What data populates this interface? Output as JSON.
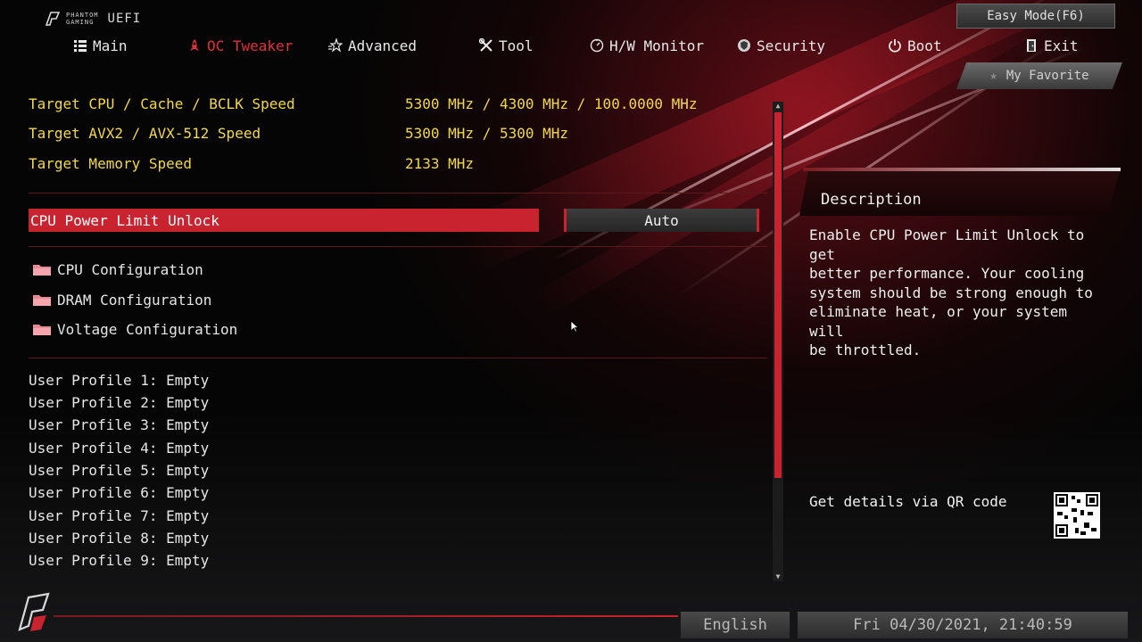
{
  "header": {
    "brand_top": "PHANTOM",
    "brand_bottom": "GAMING",
    "brand_suffix": "UEFI",
    "easy_mode_label": "Easy Mode(F6)",
    "favorite_label": "My Favorite"
  },
  "nav": {
    "tabs": [
      {
        "label": "Main",
        "icon": "list-icon",
        "active": false
      },
      {
        "label": "OC Tweaker",
        "icon": "rocket-icon",
        "active": true
      },
      {
        "label": "Advanced",
        "icon": "star-icon",
        "active": false
      },
      {
        "label": "Tool",
        "icon": "wrench-screwdriver-icon",
        "active": false
      },
      {
        "label": "H/W Monitor",
        "icon": "gauge-icon",
        "active": false
      },
      {
        "label": "Security",
        "icon": "shield-icon",
        "active": false
      },
      {
        "label": "Boot",
        "icon": "power-icon",
        "active": false
      },
      {
        "label": "Exit",
        "icon": "exit-door-icon",
        "active": false
      }
    ]
  },
  "targets": [
    {
      "label": "Target CPU / Cache / BCLK Speed",
      "value": "5300 MHz / 4300 MHz / 100.0000 MHz"
    },
    {
      "label": "Target AVX2 / AVX-512 Speed",
      "value": "5300 MHz / 5300 MHz"
    },
    {
      "label": "Target Memory Speed",
      "value": "2133 MHz"
    }
  ],
  "selected_option": {
    "label": "CPU Power Limit Unlock",
    "value": "Auto"
  },
  "folders": [
    {
      "label": "CPU Configuration"
    },
    {
      "label": "DRAM Configuration"
    },
    {
      "label": "Voltage Configuration"
    }
  ],
  "profiles": [
    "User Profile 1: Empty",
    "User Profile 2: Empty",
    "User Profile 3: Empty",
    "User Profile 4: Empty",
    "User Profile 5: Empty",
    "User Profile 6: Empty",
    "User Profile 7: Empty",
    "User Profile 8: Empty",
    "User Profile 9: Empty"
  ],
  "description": {
    "title": "Description",
    "lines": [
      "Enable CPU Power Limit Unlock to get",
      "better performance. Your cooling",
      "system should be strong enough to",
      "eliminate heat, or your system will",
      "be throttled."
    ],
    "qr_label": "Get details via QR code"
  },
  "footer": {
    "language": "English",
    "datetime": "Fri 04/30/2021, 21:40:59"
  },
  "colors": {
    "accent": "#c8232f",
    "highlight_text": "#f2d84a",
    "active_tab": "#e0303a"
  }
}
